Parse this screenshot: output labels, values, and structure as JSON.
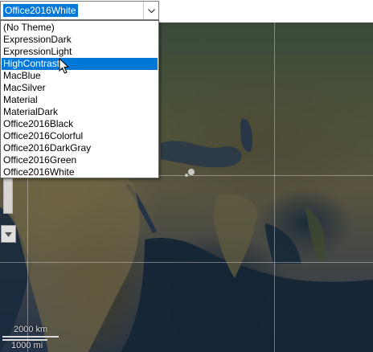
{
  "theme_selector": {
    "value": "Office2016White",
    "options": [
      "(No Theme)",
      "ExpressionDark",
      "ExpressionLight",
      "HighContrast",
      "MacBlue",
      "MacSilver",
      "Material",
      "MaterialDark",
      "Office2016Black",
      "Office2016Colorful",
      "Office2016DarkGray",
      "Office2016Green",
      "Office2016White"
    ],
    "highlighted_option": "HighContrast"
  },
  "map": {
    "scale_km": "2000 km",
    "scale_mi": "1000 mi"
  },
  "icons": {
    "dropdown": "chevron-down-icon",
    "zoom_out": "caret-down-icon",
    "cursor": "mouse-pointer-icon"
  },
  "colors": {
    "selection": "#0078d7"
  }
}
